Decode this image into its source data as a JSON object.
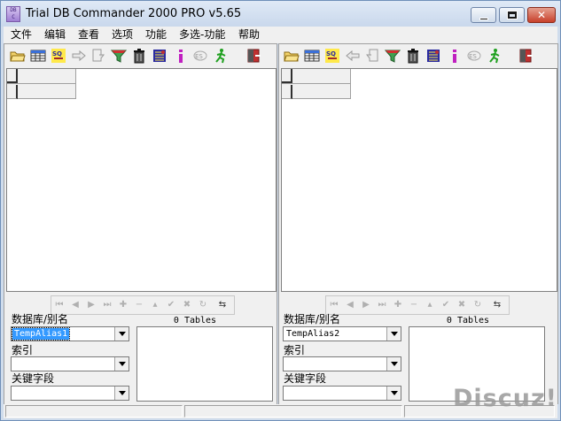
{
  "window": {
    "title": "Trial DB Commander 2000 PRO v5.65",
    "icon_text": "DB C",
    "close_glyph": "✕"
  },
  "menu": [
    {
      "label": "文件"
    },
    {
      "label": "编辑"
    },
    {
      "label": "查看"
    },
    {
      "label": "选项"
    },
    {
      "label": "功能"
    },
    {
      "label": "多选-功能"
    },
    {
      "label": "帮助"
    }
  ],
  "toolbar_icons": [
    "open-folder-icon",
    "table-icon",
    "sql-icon",
    "arrow-icon",
    "copy-doc-icon",
    "filter-icon",
    "trash-icon",
    "database-icon",
    "info-icon",
    "sql-edit-icon",
    "run-icon",
    "exit-icon"
  ],
  "left": {
    "alias_label": "数据库/别名",
    "alias_value": "TempAlias1",
    "index_label": "索引",
    "index_value": "",
    "key_label": "关键字段",
    "key_value": "",
    "tables_label": "0 Tables"
  },
  "right": {
    "alias_label": "数据库/别名",
    "alias_value": "TempAlias2",
    "index_label": "索引",
    "index_value": "",
    "key_label": "关键字段",
    "key_value": "",
    "tables_label": "0 Tables"
  },
  "nav_icons": [
    "first-record-icon",
    "prior-record-icon",
    "next-record-icon",
    "last-record-icon",
    "insert-record-icon",
    "delete-record-icon",
    "edit-record-icon",
    "post-record-icon",
    "cancel-record-icon",
    "refresh-record-icon",
    "apply-updates-icon"
  ],
  "nav_glyphs": [
    "⏮",
    "◀",
    "▶",
    "⏭",
    "✚",
    "−",
    "▴",
    "✔",
    "✖",
    "↻",
    "⇆"
  ],
  "watermark": "Discuz!",
  "colors": {
    "titlebar": "#dfe9f6",
    "selection": "#3399ff",
    "close_button": "#c7402b",
    "panel": "#f0f0f0"
  }
}
